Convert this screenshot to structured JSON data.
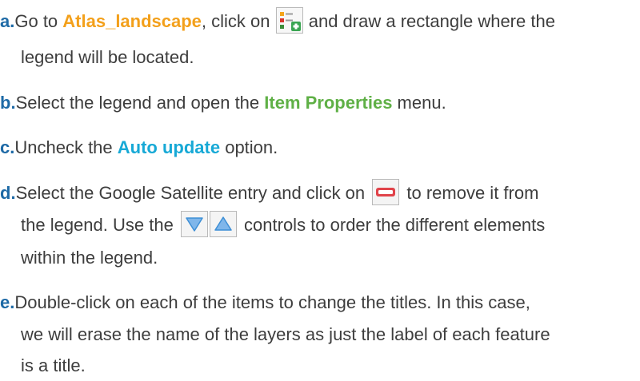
{
  "steps": [
    {
      "letter": "a.",
      "text1": "Go to ",
      "atlas": "Atlas_landscape",
      "text2": ", click on ",
      "text3": " and draw a rectangle where the",
      "text4": "legend will be located.",
      "icon": "add-legend-icon"
    },
    {
      "letter": "b.",
      "text1": "Select the legend and open the ",
      "item_properties": "Item Properties",
      "text2": " menu."
    },
    {
      "letter": "c.",
      "text1": "Uncheck the ",
      "auto_update": "Auto update",
      "text2": " option."
    },
    {
      "letter": "d.",
      "text1": "Select the Google Satellite entry and click on ",
      "text2": " to remove it from",
      "text3": "the legend. Use the ",
      "text4": " controls to order the different elements",
      "text5": "within the legend.",
      "icons": [
        "remove-item-icon",
        "move-down-icon",
        "move-up-icon"
      ]
    },
    {
      "letter": "e.",
      "text1": "Double-click on each of the items to change the titles. In this case,",
      "text2": "we will erase the name of the layers as just the label of each feature",
      "text3": "is a title."
    }
  ],
  "colors": {
    "step_letter": "#1e6aa6",
    "atlas": "#f3a01b",
    "item_properties": "#5fb046",
    "auto_update": "#17a9d6",
    "body_text": "#3d3d3d",
    "remove_icon": "#e0434a",
    "arrow_icon": "#3d8fd6"
  }
}
